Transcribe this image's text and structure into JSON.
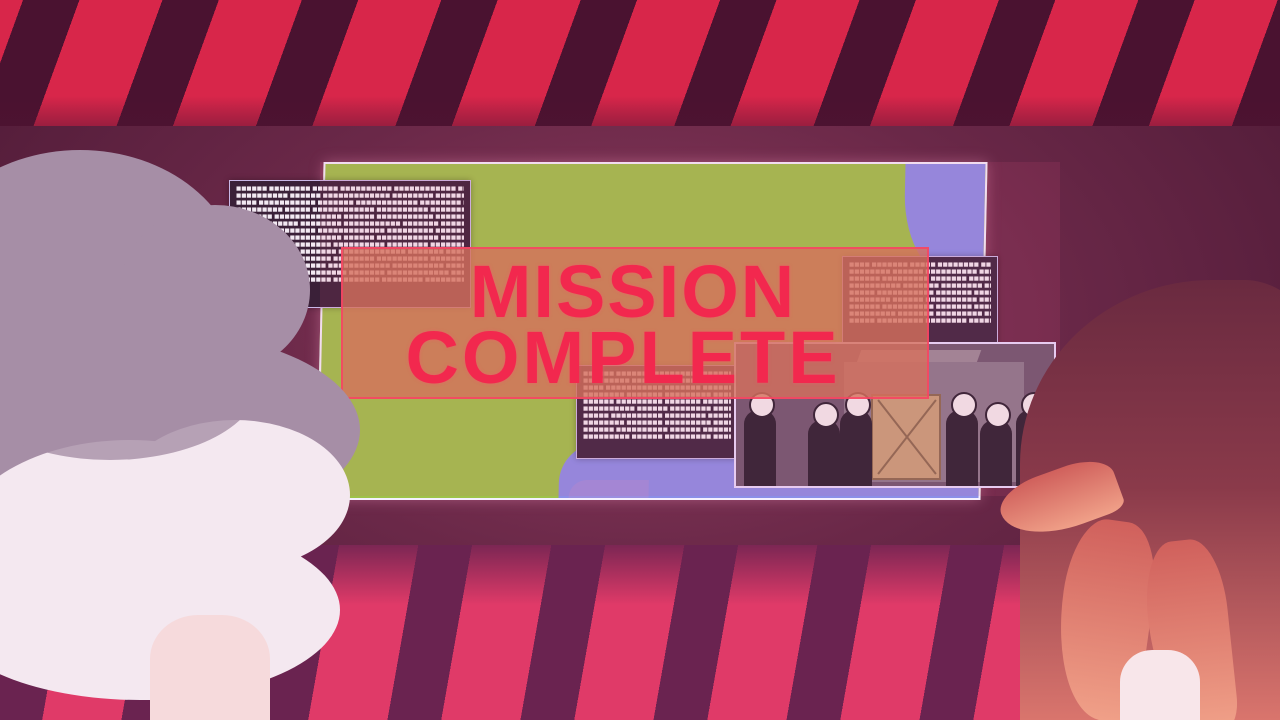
{
  "banner": {
    "line1": "MISSION",
    "line2": "COMPLETE"
  },
  "colors": {
    "stripe_red": "#d8264a",
    "stripe_pink": "#e03a68",
    "banner_text": "#f2284e",
    "map_green": "#9ec24a",
    "water_blue": "#8b8ee8"
  }
}
